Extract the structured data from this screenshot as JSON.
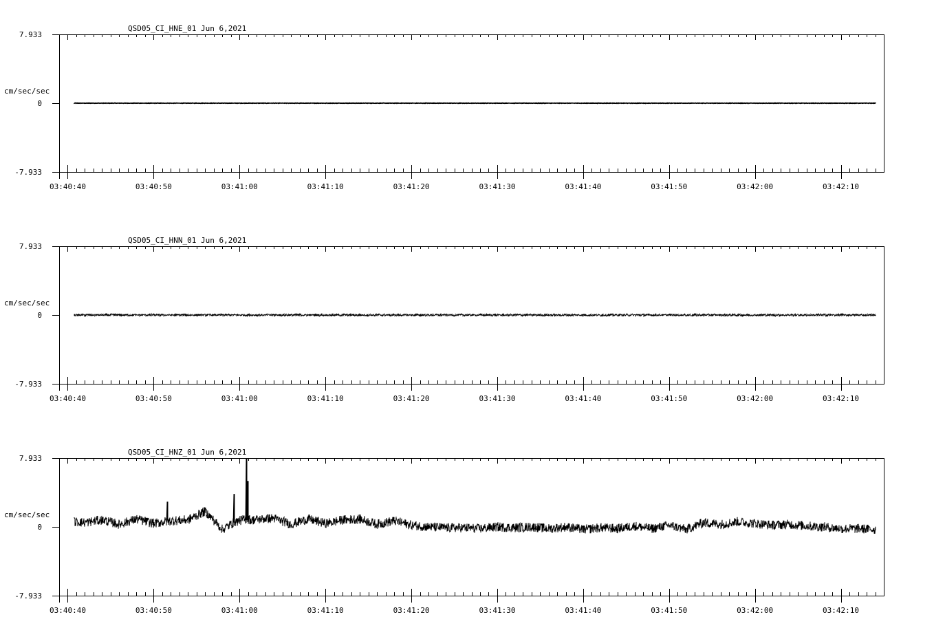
{
  "chart_data": [
    {
      "type": "line",
      "title": "QSD05_CI_HNE_01  Jun 6,2021",
      "ylabel": "cm/sec/sec",
      "ylim": [
        -7.933,
        7.933
      ],
      "yticks": [
        "7.933",
        "0",
        "-7.933"
      ],
      "xticks": [
        "03:40:40",
        "03:40:50",
        "03:41:00",
        "03:41:10",
        "03:41:20",
        "03:41:30",
        "03:41:40",
        "03:41:50",
        "03:42:00",
        "03:42:10"
      ],
      "xlim_seconds": [
        -1.0,
        95.0
      ],
      "data_start_seconds": 0.8,
      "data_end_seconds": 94.0,
      "series": [
        {
          "name": "",
          "noise_amplitude": 0.02,
          "trace": "flat"
        }
      ]
    },
    {
      "type": "line",
      "title": "QSD05_CI_HNN_01  Jun 6,2021",
      "ylabel": "cm/sec/sec",
      "ylim": [
        -7.933,
        7.933
      ],
      "yticks": [
        "7.933",
        "0",
        "-7.933"
      ],
      "xticks": [
        "03:40:40",
        "03:40:50",
        "03:41:00",
        "03:41:10",
        "03:41:20",
        "03:41:30",
        "03:41:40",
        "03:41:50",
        "03:42:00",
        "03:42:10"
      ],
      "xlim_seconds": [
        -1.0,
        95.0
      ],
      "data_start_seconds": 0.8,
      "data_end_seconds": 94.0,
      "series": [
        {
          "name": "",
          "noise_amplitude": 0.12,
          "trace": "noise"
        }
      ]
    },
    {
      "type": "line",
      "title": "QSD05_CI_HNZ_01  Jun 6,2021",
      "ylabel": "cm/sec/sec",
      "ylim": [
        -7.933,
        7.933
      ],
      "yticks": [
        "7.933",
        "0",
        "-7.933"
      ],
      "xticks": [
        "03:40:40",
        "03:40:50",
        "03:41:00",
        "03:41:10",
        "03:41:20",
        "03:41:30",
        "03:41:40",
        "03:41:50",
        "03:42:00",
        "03:42:10"
      ],
      "xlim_seconds": [
        -1.0,
        95.0
      ],
      "data_start_seconds": 0.8,
      "data_end_seconds": 94.0,
      "series": [
        {
          "name": "",
          "trace": "envelope",
          "envelope_seconds": [
            0.8,
            2,
            4,
            6,
            8,
            10,
            12,
            14,
            16,
            18,
            19.5,
            20.8,
            21.5,
            22.5,
            24,
            26,
            28,
            30,
            32,
            34,
            36,
            38,
            40,
            42,
            44,
            46,
            48,
            50,
            52,
            54,
            56,
            58,
            60,
            62,
            64,
            66,
            68,
            70,
            72,
            74,
            76,
            78,
            80,
            82,
            84,
            86,
            88,
            90,
            92,
            94
          ],
          "envelope_values": [
            0.6,
            0.5,
            0.8,
            0.3,
            0.9,
            0.4,
            0.7,
            0.8,
            1.8,
            -0.3,
            0.6,
            0.9,
            0.8,
            0.9,
            1.0,
            0.3,
            0.9,
            0.4,
            0.8,
            0.9,
            0.3,
            0.7,
            0.2,
            0.0,
            -0.1,
            -0.1,
            -0.2,
            0.0,
            -0.1,
            0.0,
            -0.2,
            0.0,
            -0.3,
            -0.1,
            -0.2,
            0.1,
            -0.2,
            0.2,
            -0.3,
            0.5,
            0.3,
            0.6,
            0.4,
            0.2,
            0.3,
            0.1,
            0.0,
            -0.2,
            -0.2,
            -0.3
          ],
          "spikes": [
            {
              "t": 19.4,
              "v": 3.8
            },
            {
              "t": 20.8,
              "v": 7.9
            },
            {
              "t": 21.0,
              "v": 5.3
            },
            {
              "t": 11.6,
              "v": 2.9
            }
          ],
          "noise_amplitude": 0.55
        }
      ]
    }
  ]
}
